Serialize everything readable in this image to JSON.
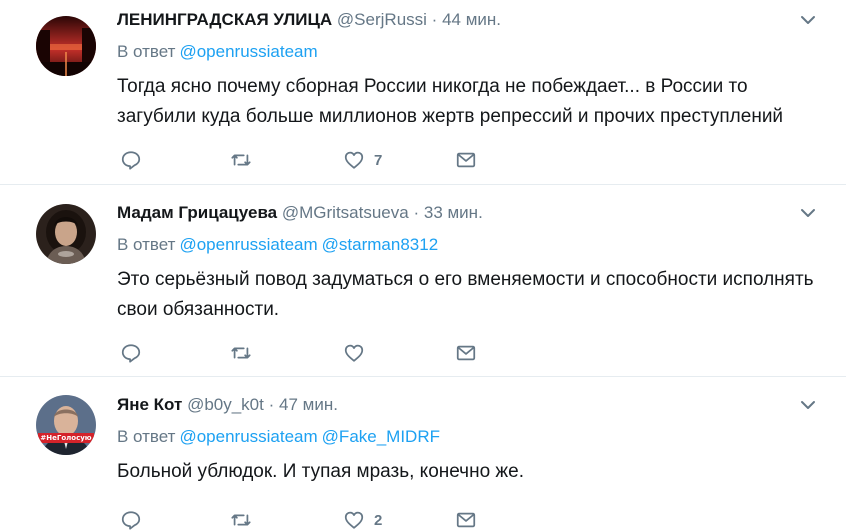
{
  "tweets": [
    {
      "name": "ЛЕНИНГРАДСКАЯ УЛИЦА",
      "handle": "@SerjRussi",
      "dot": "·",
      "time": "44 мин.",
      "reply_prefix": "В ответ",
      "mentions": [
        "@openrussiateam"
      ],
      "text": "Тогда ясно почему сборная России никогда не побеждает... в России то загубили куда больше миллионов жертв репрессий и прочих преступлений",
      "like_count": "7",
      "avatar_icon": "red-street-photo-avatar"
    },
    {
      "name": "Мадам Грицацуева",
      "handle": "@MGritsatsueva",
      "dot": "·",
      "time": "33 мин.",
      "reply_prefix": "В ответ",
      "mentions": [
        "@openrussiateam",
        "@starman8312"
      ],
      "text": "Это серьёзный повод задуматься о его вменяемости и способности исполнять свои обязанности.",
      "like_count": "",
      "avatar_icon": "woman-portrait-avatar"
    },
    {
      "name": "Яне Кот",
      "handle": "@b0y_k0t",
      "dot": "·",
      "time": "47 мин.",
      "reply_prefix": "В ответ",
      "mentions": [
        "@openrussiateam",
        "@Fake_MIDRF"
      ],
      "text": "Больной ублюдок. И тупая мразь, конечно же.",
      "like_count": "2",
      "avatar_badge": "#НеГолосую",
      "avatar_icon": "man-portrait-avatar"
    }
  ],
  "colors": {
    "accent": "#1da1f2",
    "secondary_text": "#657786",
    "primary_text": "#14171a",
    "divider": "#e6ecf0"
  }
}
